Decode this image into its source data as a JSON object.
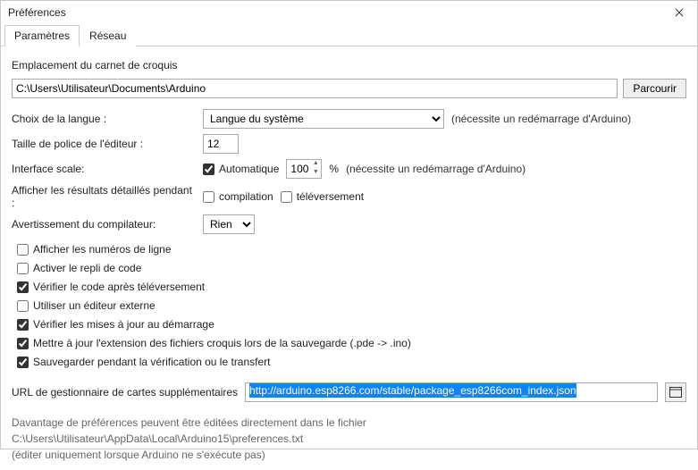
{
  "window": {
    "title": "Préférences"
  },
  "tabs": {
    "settings": "Paramètres",
    "network": "Réseau"
  },
  "sketch": {
    "label": "Emplacement du carnet de croquis",
    "path": "C:\\Users\\Utilisateur\\Documents\\Arduino",
    "browse": "Parcourir"
  },
  "language": {
    "label": "Choix de la langue :",
    "value": "Langue du système",
    "hint": "(nécessite un redémarrage d'Arduino)"
  },
  "fontsize": {
    "label": "Taille de police de l'éditeur :",
    "value": "12"
  },
  "iface": {
    "label": "Interface scale:",
    "auto": "Automatique",
    "value": "100",
    "pct": "%",
    "hint": "(nécessite un redémarrage d'Arduino)"
  },
  "verbose": {
    "label": "Afficher les résultats détaillés pendant :",
    "compilation": "compilation",
    "upload": "téléversement"
  },
  "warnings": {
    "label": "Avertissement du compilateur:",
    "value": "Rien"
  },
  "opts": {
    "linenum": "Afficher les numéros de ligne",
    "codefold": "Activer le repli de code",
    "verify": "Vérifier le code après téléversement",
    "extedit": "Utiliser un éditeur externe",
    "checkup": "Vérifier les mises à jour au démarrage",
    "updateext": "Mettre à jour  l'extension des fichiers croquis lors de la sauvegarde (.pde -> .ino)",
    "savebuild": "Sauvegarder pendant la vérification ou le transfert"
  },
  "boards": {
    "label": "URL de gestionnaire de cartes supplémentaires",
    "url": "http://arduino.esp8266.com/stable/package_esp8266com_index.json"
  },
  "footer": {
    "l1": "Davantage de préférences peuvent être éditées directement dans le fichier",
    "l2": "C:\\Users\\Utilisateur\\AppData\\Local\\Arduino15\\preferences.txt",
    "l3": "(éditer uniquement lorsque Arduino ne s'exécute pas)"
  }
}
